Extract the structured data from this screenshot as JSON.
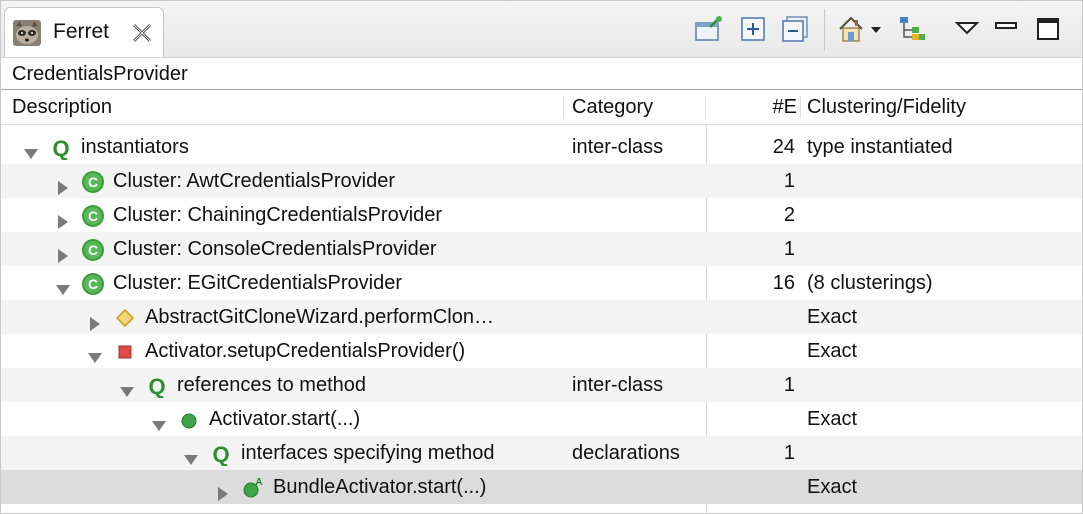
{
  "view": {
    "tab_label": "Ferret",
    "subtitle": "CredentialsProvider"
  },
  "icons": {
    "tab": "raccoon-icon",
    "close": "close-icon",
    "toolbar": [
      "pin-view-icon",
      "expand-all-icon",
      "collapse-all-icon",
      "home-icon",
      "dropdown-arrow-icon",
      "hierarchy-icon",
      "view-menu-icon",
      "minimize-icon",
      "maximize-icon"
    ]
  },
  "columns": {
    "description": "Description",
    "category": "Category",
    "count": "#E",
    "clustering": "Clustering/Fidelity"
  },
  "rows": [
    {
      "level": 0,
      "twisty": "expanded",
      "icon": "query-icon",
      "label": "instantiators",
      "category": "inter-class",
      "count": "24",
      "clustering": "type instantiated"
    },
    {
      "level": 1,
      "twisty": "collapsed",
      "icon": "class-icon",
      "label": "Cluster: AwtCredentialsProvider",
      "category": "",
      "count": "1",
      "clustering": ""
    },
    {
      "level": 1,
      "twisty": "collapsed",
      "icon": "class-icon",
      "label": "Cluster: ChainingCredentialsProvider",
      "category": "",
      "count": "2",
      "clustering": ""
    },
    {
      "level": 1,
      "twisty": "collapsed",
      "icon": "class-icon",
      "label": "Cluster: ConsoleCredentialsProvider",
      "category": "",
      "count": "1",
      "clustering": ""
    },
    {
      "level": 1,
      "twisty": "expanded",
      "icon": "class-icon",
      "label": "Cluster: EGitCredentialsProvider",
      "category": "",
      "count": "16",
      "clustering": "(8 clusterings)"
    },
    {
      "level": 2,
      "twisty": "collapsed",
      "icon": "protected-method-icon",
      "label": "AbstractGitCloneWizard.performClon…",
      "category": "",
      "count": "",
      "clustering": "Exact"
    },
    {
      "level": 2,
      "twisty": "expanded",
      "icon": "private-method-icon",
      "label": "Activator.setupCredentialsProvider()",
      "category": "",
      "count": "",
      "clustering": "Exact"
    },
    {
      "level": 3,
      "twisty": "expanded",
      "icon": "query-icon",
      "label": "references to method",
      "category": "inter-class",
      "count": "1",
      "clustering": ""
    },
    {
      "level": 4,
      "twisty": "expanded",
      "icon": "public-method-icon",
      "label": "Activator.start(...)",
      "category": "",
      "count": "",
      "clustering": "Exact"
    },
    {
      "level": 5,
      "twisty": "expanded",
      "icon": "query-icon",
      "label": "interfaces specifying method",
      "category": "declarations",
      "count": "1",
      "clustering": ""
    },
    {
      "level": 6,
      "twisty": "collapsed",
      "icon": "abstract-method-icon",
      "label": "BundleActivator.start(...)",
      "category": "",
      "count": "",
      "clustering": "Exact",
      "selected": true
    }
  ]
}
